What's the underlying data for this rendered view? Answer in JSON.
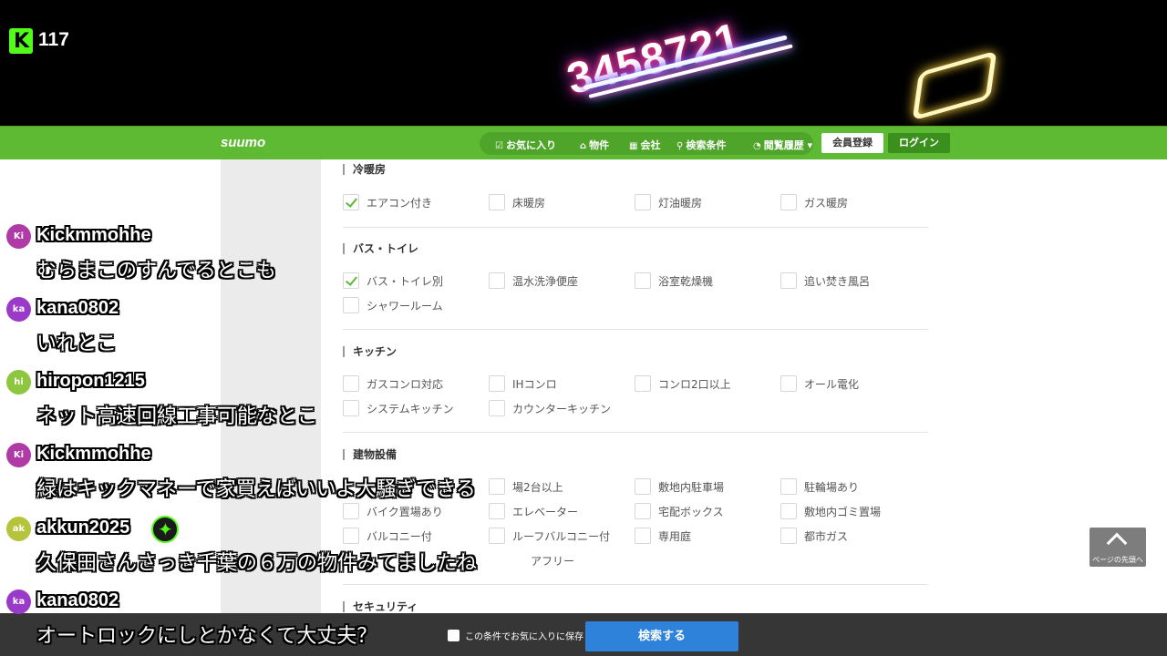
{
  "stream": {
    "logo_letter": "K",
    "viewer_count": "117",
    "neon_text": "3458721"
  },
  "header": {
    "logo": "suumo",
    "nav": [
      {
        "icon": "heart-icon",
        "label": "お気に入り"
      },
      {
        "icon": "home-icon",
        "label": "物件"
      },
      {
        "icon": "building-icon",
        "label": "会社"
      },
      {
        "icon": "search-icon",
        "label": "検索条件"
      },
      {
        "icon": "clock-icon",
        "label": "閲覧履歴"
      }
    ],
    "register": "会員登録",
    "login": "ログイン"
  },
  "sections": [
    {
      "title": "冷暖房",
      "options": [
        {
          "label": "エアコン付き",
          "checked": true
        },
        {
          "label": "床暖房",
          "checked": false
        },
        {
          "label": "灯油暖房",
          "checked": false
        },
        {
          "label": "ガス暖房",
          "checked": false
        }
      ]
    },
    {
      "title": "バス・トイレ",
      "options": [
        {
          "label": "バス・トイレ別",
          "checked": true
        },
        {
          "label": "温水洗浄便座",
          "checked": false
        },
        {
          "label": "浴室乾燥機",
          "checked": false
        },
        {
          "label": "追い焚き風呂",
          "checked": false
        },
        {
          "label": "シャワールーム",
          "checked": false
        }
      ]
    },
    {
      "title": "キッチン",
      "options": [
        {
          "label": "ガスコンロ対応",
          "checked": false
        },
        {
          "label": "IHコンロ",
          "checked": false
        },
        {
          "label": "コンロ2口以上",
          "checked": false
        },
        {
          "label": "オール電化",
          "checked": false
        },
        {
          "label": "システムキッチン",
          "checked": false
        },
        {
          "label": "カウンターキッチン",
          "checked": false
        }
      ]
    },
    {
      "title": "建物設備",
      "options": [
        {
          "label": "",
          "checked": false
        },
        {
          "label": "場2台以上",
          "checked": false
        },
        {
          "label": "敷地内駐車場",
          "checked": false
        },
        {
          "label": "駐輪場あり",
          "checked": false
        },
        {
          "label": "バイク置場あり",
          "checked": false
        },
        {
          "label": "エレベーター",
          "checked": false
        },
        {
          "label": "宅配ボックス",
          "checked": false
        },
        {
          "label": "敷地内ゴミ置場",
          "checked": false
        },
        {
          "label": "バルコニー付",
          "checked": false
        },
        {
          "label": "ルーフバルコニー付",
          "checked": false
        },
        {
          "label": "専用庭",
          "checked": false
        },
        {
          "label": "都市ガス",
          "checked": false
        },
        {
          "label": "",
          "checked": false
        },
        {
          "label": "アフリー",
          "checked": false
        }
      ]
    },
    {
      "title": "セキュリティ",
      "options": []
    }
  ],
  "back_to_top": "ページの先頭へ",
  "bottom": {
    "save_label": "この条件でお気に入りに保存",
    "search_button": "検索する"
  },
  "chat": [
    {
      "initials": "Ki",
      "color": "#b03aa6",
      "user": "Kickmmohhe",
      "message": "むらまこのすんでるとこも"
    },
    {
      "initials": "ka",
      "color": "#9a3ac8",
      "user": "kana0802",
      "message": "いれとこ"
    },
    {
      "initials": "hi",
      "color": "#8dc63f",
      "user": "hiropon1215",
      "message": "ネット高速回線工事可能なとこ"
    },
    {
      "initials": "Ki",
      "color": "#b03aa6",
      "user": "Kickmmohhe",
      "message": "緑はキックマネーで家買えばいいよ大騒ぎできる"
    },
    {
      "initials": "ak",
      "color": "#b5c43a",
      "user": "akkun2025",
      "message": "久保田さんさっき千葉の６万の物件みてましたね"
    },
    {
      "initials": "ka",
      "color": "#9a3ac8",
      "user": "kana0802",
      "message": "オートロックにしとかなくて大丈夫？"
    }
  ]
}
